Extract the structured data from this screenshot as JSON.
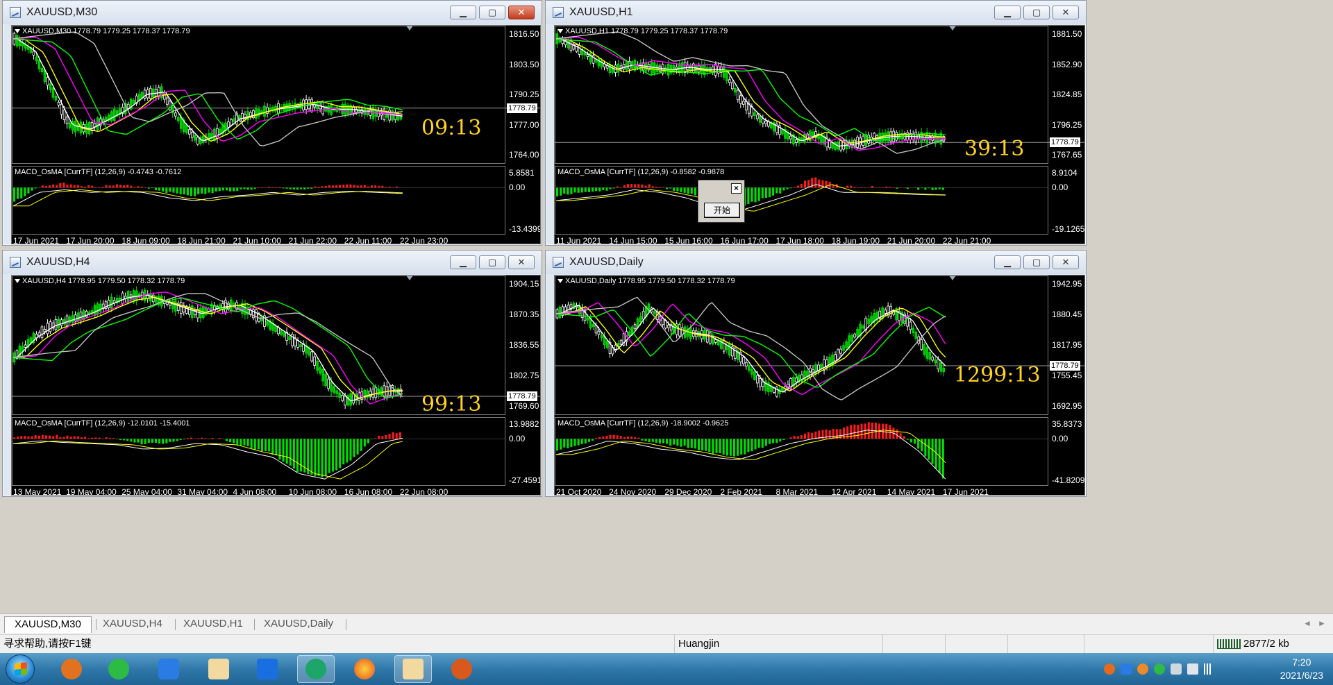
{
  "windows": [
    {
      "title": "XAUUSD,M30",
      "header": "XAUUSD,M30  1778.79 1779.25 1778.37 1778.79",
      "macd_header": "MACD_OsMA [CurrTF] (12,26,9) -0.4743 -0.7612",
      "price_labels": [
        "1816.50",
        "1803.50",
        "1790.25",
        "1777.00",
        "1764.00"
      ],
      "current_price": "1778.79",
      "macd_labels": [
        "5.8581",
        "0.00",
        "-13.4399"
      ],
      "dates": [
        "17 Jun 2021",
        "17 Jun 20:00",
        "18 Jun 09:00",
        "18 Jun 21:00",
        "21 Jun 10:00",
        "21 Jun 22:00",
        "22 Jun 11:00",
        "22 Jun 23:00"
      ],
      "timer": "09:13"
    },
    {
      "title": "XAUUSD,H1",
      "header": "XAUUSD,H1  1778.79 1779.25 1778.37 1778.79",
      "macd_header": "MACD_OsMA [CurrTF] (12,26,9) -0.8582 -0.9878",
      "price_labels": [
        "1881.50",
        "1852.90",
        "1824.85",
        "1796.25",
        "1767.65"
      ],
      "current_price": "1778.79",
      "macd_labels": [
        "8.9104",
        "0.00",
        "-19.1265"
      ],
      "dates": [
        "11 Jun 2021",
        "14 Jun 15:00",
        "15 Jun 16:00",
        "16 Jun 17:00",
        "17 Jun 18:00",
        "18 Jun 19:00",
        "21 Jun 20:00",
        "22 Jun 21:00"
      ],
      "timer": "39:13"
    },
    {
      "title": "XAUUSD,H4",
      "header": "XAUUSD,H4  1778.95 1779.50 1778.32 1778.79",
      "macd_header": "MACD_OsMA [CurrTF] (12,26,9) -12.0101 -15.4001",
      "price_labels": [
        "1904.15",
        "1870.35",
        "1836.55",
        "1802.75",
        "1769.60"
      ],
      "current_price": "1778.79",
      "macd_labels": [
        "13.9882",
        "0.00",
        "-27.4591"
      ],
      "dates": [
        "13 May 2021",
        "19 May 04:00",
        "25 May 04:00",
        "31 May 04:00",
        "4 Jun 08:00",
        "10 Jun 08:00",
        "16 Jun 08:00",
        "22 Jun 08:00"
      ],
      "timer": "99:13"
    },
    {
      "title": "XAUUSD,Daily",
      "header": "XAUUSD,Daily  1778.95 1779.50 1778.32 1778.79",
      "macd_header": "MACD_OsMA [CurrTF] (12,26,9) -18.9002 -0.9625",
      "price_labels": [
        "1942.95",
        "1880.45",
        "1817.95",
        "1755.45",
        "1692.95"
      ],
      "current_price": "1778.79",
      "macd_labels": [
        "35.8373",
        "0.00",
        "-41.8209"
      ],
      "dates": [
        "21 Oct 2020",
        "24 Nov 2020",
        "29 Dec 2020",
        "2 Feb 2021",
        "8 Mar 2021",
        "12 Apr 2021",
        "14 May 2021",
        "17 Jun 2021"
      ],
      "timer": "1299:13"
    }
  ],
  "popup": {
    "button": "开始",
    "close": "×"
  },
  "tabs": [
    "XAUUSD,M30",
    "XAUUSD,H4",
    "XAUUSD,H1",
    "XAUUSD,Daily"
  ],
  "status": {
    "help": "寻求帮助,请按F1键",
    "profile": "Huangjin",
    "traffic": "2877/2 kb"
  },
  "clock": {
    "time": "7:20",
    "date": "2021/6/23"
  },
  "window_buttons": {
    "minimize": "▁",
    "maximize": "▢",
    "close": "✕"
  },
  "taskbar_apps": [
    "windows-start",
    "foxmail",
    "wechat",
    "feishu-pen",
    "trading-terminal",
    "tencent-meeting",
    "cyber-app",
    "firefox",
    "trading-terminal-2",
    "raccoon-app"
  ],
  "tab_nav": {
    "left": "◄",
    "right": "►"
  }
}
